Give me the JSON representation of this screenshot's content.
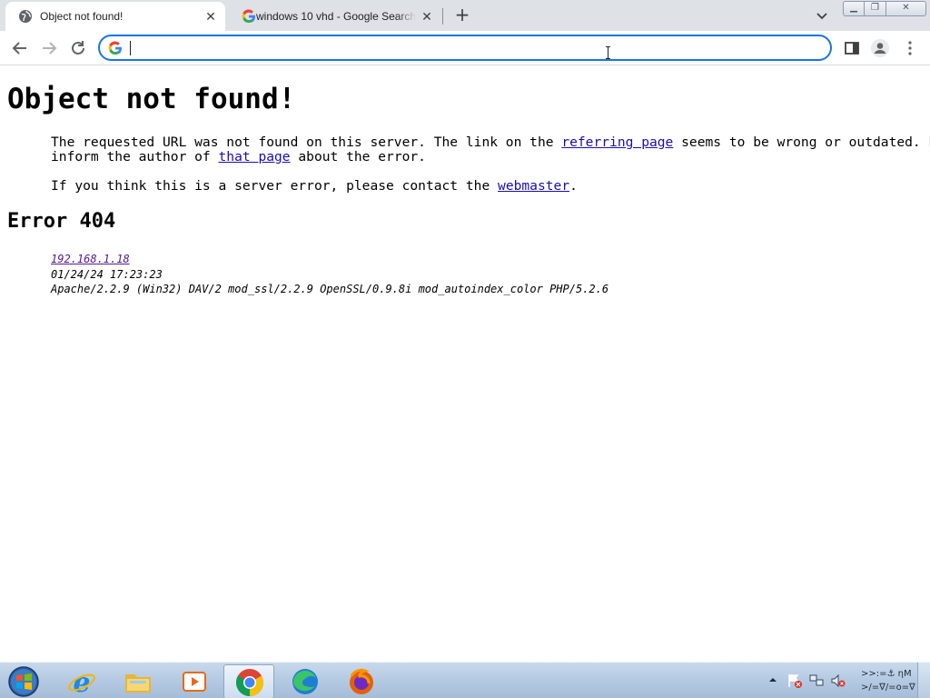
{
  "browser": {
    "tabs": [
      {
        "title": "Object not found!",
        "active": true,
        "favicon": "globe-icon"
      },
      {
        "title": "windows 10 vhd - Google Search",
        "active": false,
        "favicon": "google-icon"
      }
    ],
    "omnibox": {
      "value": "",
      "placeholder": ""
    },
    "accent_color": "#1a73e8"
  },
  "page": {
    "heading": "Object not found!",
    "p1_a": "The requested URL was not found on this server. The link on the ",
    "p1_link1": "referring page",
    "p1_b": " seems to be wrong or outdated. Please\ninform the author of ",
    "p1_link2": "that page",
    "p1_c": " about the error.",
    "p2_a": "If you think this is a server error, please contact the ",
    "p2_link": "webmaster",
    "p2_b": ".",
    "error_heading": "Error 404",
    "footer": {
      "host": "192.168.1.18",
      "timestamp": "01/24/24 17:23:23",
      "server": "Apache/2.2.9 (Win32) DAV/2 mod_ssl/2.2.9 OpenSSL/0.9.8i mod_autoindex_color PHP/5.2.6"
    },
    "link_color": "#1a0dab"
  },
  "taskbar": {
    "apps": [
      "start-orb",
      "internet-explorer",
      "file-explorer",
      "media-player",
      "chrome",
      "edge",
      "firefox"
    ],
    "active_app": "chrome",
    "clock_line1": ">>:=⚓ ηΜ",
    "clock_line2": ">/=∇/=o=∇"
  }
}
